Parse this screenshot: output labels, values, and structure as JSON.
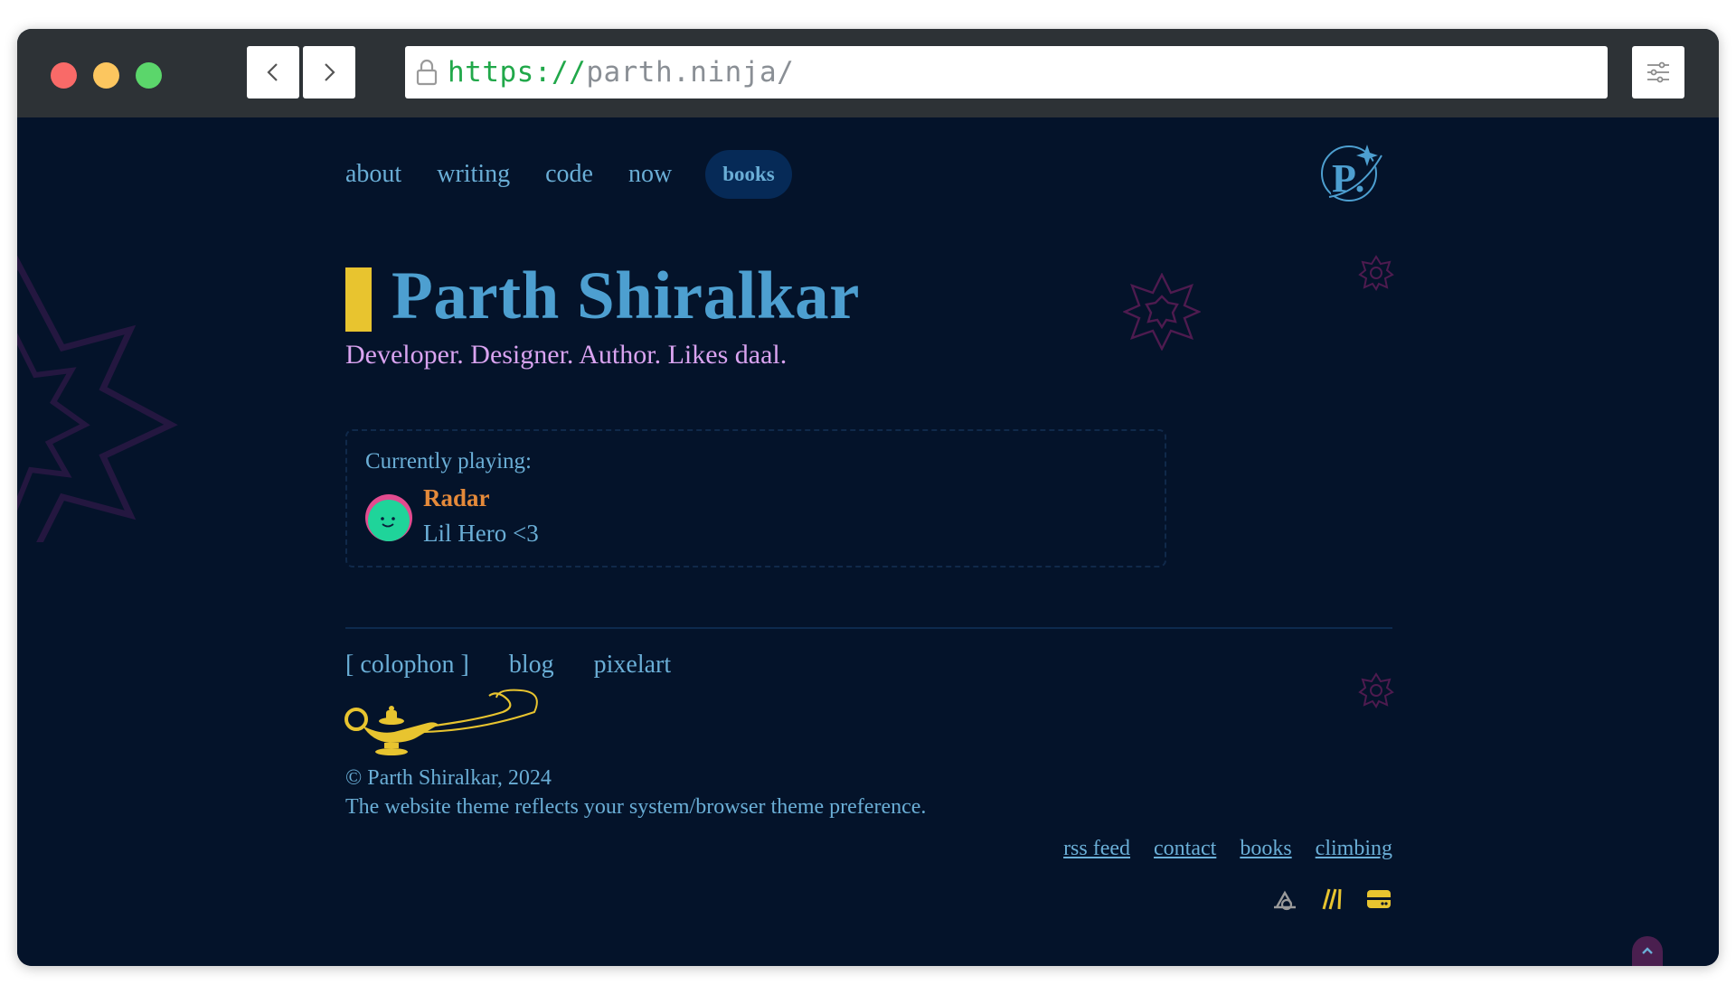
{
  "browser": {
    "url_protocol": "https://",
    "url_host": "parth.ninja/"
  },
  "nav": {
    "items": [
      {
        "label": "about"
      },
      {
        "label": "writing"
      },
      {
        "label": "code"
      },
      {
        "label": "now"
      },
      {
        "label": "books"
      }
    ],
    "active": "books"
  },
  "hero": {
    "title": "Parth Shiralkar",
    "tagline": "Developer. Designer. Author. Likes daal."
  },
  "now_playing": {
    "label": "Currently playing:",
    "track": "Radar",
    "artist": "Lil Hero <3"
  },
  "footer": {
    "links": [
      {
        "label": "[ colophon ]"
      },
      {
        "label": "blog"
      },
      {
        "label": "pixelart"
      }
    ],
    "copyright": "© Parth Shiralkar, 2024",
    "theme_note": "The website theme reflects your system/browser theme preference.",
    "bottom_links": [
      {
        "label": "rss feed"
      },
      {
        "label": "contact"
      },
      {
        "label": "books"
      },
      {
        "label": "climbing"
      }
    ],
    "icons": [
      "triangle-icon",
      "stripes-icon",
      "card-icon"
    ]
  },
  "colors": {
    "background": "#04132a",
    "accent_yellow": "#e8c42f",
    "title_blue": "#4d9fd0",
    "tagline_pink": "#d9a3f0",
    "track_orange": "#e58a3a",
    "link_blue": "#6aaed6"
  }
}
